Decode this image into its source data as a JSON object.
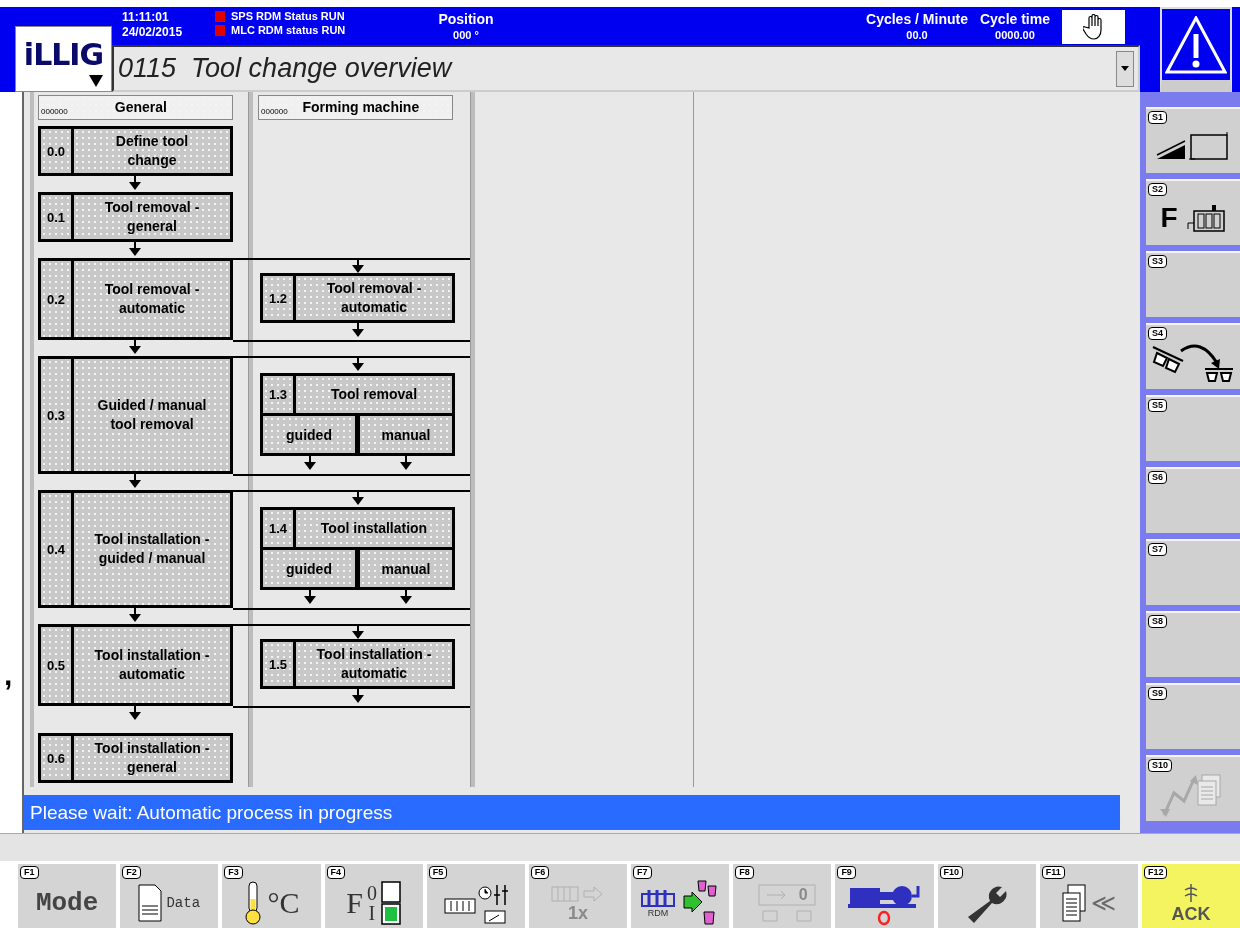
{
  "header": {
    "logo": "iLLIG",
    "time": "11:11:01",
    "date": "24/02/2015",
    "status_lines": [
      "SPS RDM Status RUN",
      "MLC RDM status RUN"
    ],
    "position": {
      "label": "Position",
      "value": "000 °"
    },
    "cycles_per_minute": {
      "label": "Cycles / Minute",
      "value": "00.0"
    },
    "cycle_time": {
      "label": "Cycle time",
      "value": "0000.00"
    }
  },
  "screen_selector": {
    "value": "0115  Tool change overview"
  },
  "diagram": {
    "columns": [
      {
        "title": "General",
        "code": "000000"
      },
      {
        "title": "Forming machine",
        "code": "000000"
      }
    ],
    "rows": [
      {
        "general": {
          "number": "0.0",
          "label": "Define tool change"
        }
      },
      {
        "general": {
          "number": "0.1",
          "label": "Tool removal - general"
        }
      },
      {
        "general": {
          "number": "0.2",
          "label": "Tool removal - automatic"
        },
        "forming": {
          "number": "1.2",
          "label": "Tool removal - automatic"
        }
      },
      {
        "general": {
          "number": "0.3",
          "label": "Guided / manual tool removal"
        },
        "forming": {
          "number": "1.3",
          "label": "Tool removal",
          "options": [
            "guided",
            "manual"
          ]
        }
      },
      {
        "general": {
          "number": "0.4",
          "label": "Tool installation - guided / manual"
        },
        "forming": {
          "number": "1.4",
          "label": "Tool installation",
          "options": [
            "guided",
            "manual"
          ]
        }
      },
      {
        "general": {
          "number": "0.5",
          "label": "Tool installation - automatic"
        },
        "forming": {
          "number": "1.5",
          "label": "Tool installation - automatic"
        }
      },
      {
        "general": {
          "number": "0.6",
          "label": "Tool installation - general"
        }
      }
    ]
  },
  "message": "Please wait: Automatic process in progress",
  "stray_mark": ",",
  "side_keys": [
    {
      "label": "S1",
      "kind": "ramp-frame",
      "disabled": false
    },
    {
      "label": "S2",
      "kind": "f-magazine",
      "texts": [
        "F"
      ],
      "disabled": false
    },
    {
      "label": "S3",
      "kind": "empty"
    },
    {
      "label": "S4",
      "kind": "swap",
      "disabled": false
    },
    {
      "label": "S5",
      "kind": "empty"
    },
    {
      "label": "S6",
      "kind": "empty"
    },
    {
      "label": "S7",
      "kind": "empty"
    },
    {
      "label": "S8",
      "kind": "empty"
    },
    {
      "label": "S9",
      "kind": "empty"
    },
    {
      "label": "S10",
      "kind": "cycle-docs",
      "disabled": true
    }
  ],
  "function_keys": [
    {
      "label": "F1",
      "kind": "mode",
      "texts": [
        "Mode"
      ],
      "disabled": false
    },
    {
      "label": "F2",
      "kind": "data",
      "texts": [
        "Data"
      ],
      "disabled": false
    },
    {
      "label": "F3",
      "kind": "temperature",
      "texts": [
        "°C"
      ],
      "disabled": false
    },
    {
      "label": "F4",
      "kind": "heater",
      "texts": [
        "F",
        "0",
        "I"
      ],
      "disabled": false
    },
    {
      "label": "F5",
      "kind": "settings",
      "disabled": false
    },
    {
      "label": "F6",
      "kind": "single-cycle",
      "texts": [
        "1x"
      ],
      "disabled": true
    },
    {
      "label": "F7",
      "kind": "rdm",
      "texts": [
        "RDM"
      ],
      "disabled": false
    },
    {
      "label": "F8",
      "kind": "counter",
      "texts": [
        "0"
      ],
      "disabled": true
    },
    {
      "label": "F9",
      "kind": "pump",
      "disabled": false
    },
    {
      "label": "F10",
      "kind": "wrench",
      "disabled": false
    },
    {
      "label": "F11",
      "kind": "docs-back",
      "texts": [
        "≪"
      ],
      "disabled": false
    },
    {
      "label": "F12",
      "kind": "ack",
      "texts": [
        "ACK"
      ],
      "disabled": false
    }
  ]
}
